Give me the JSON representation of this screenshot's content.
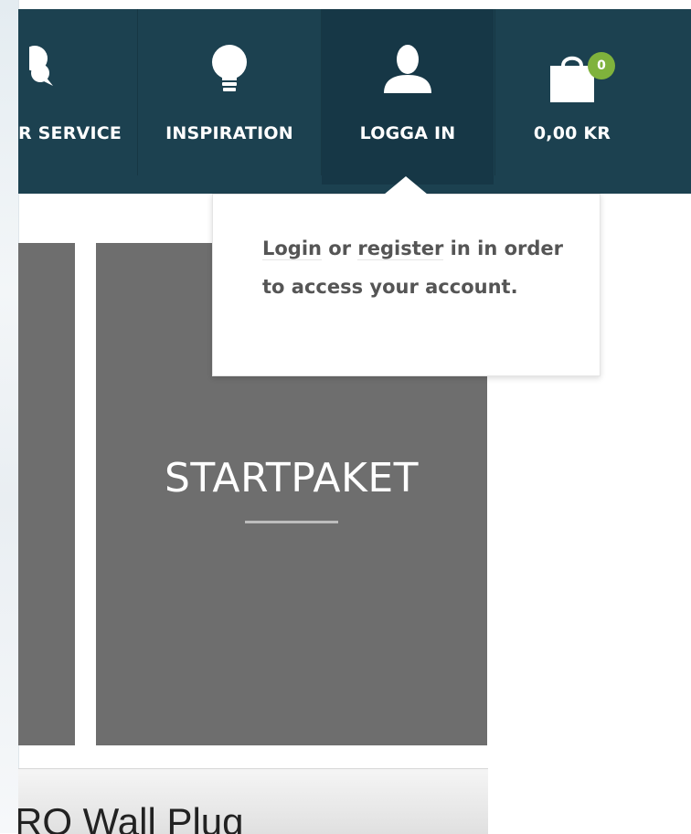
{
  "nav": {
    "items": [
      {
        "label": "R SERVICE",
        "icon": "chat-bubbles-icon"
      },
      {
        "label": "INSPIRATION",
        "icon": "lightbulb-icon"
      },
      {
        "label": "LOGGA IN",
        "icon": "user-icon"
      },
      {
        "label": "0,00 KR",
        "icon": "shopping-bag-icon"
      }
    ],
    "cart_count": "0"
  },
  "popover": {
    "login_link": "Login",
    "or_text": " or ",
    "register_link": "register",
    "rest_text": " in in order to access your account."
  },
  "tile": {
    "title": "STARTPAKET"
  },
  "product": {
    "title": "RO Wall Plug"
  },
  "colors": {
    "navbar": "#1c4150",
    "navbar_active": "#163746",
    "badge": "#7fb23c",
    "tile": "#6e6e6e"
  }
}
